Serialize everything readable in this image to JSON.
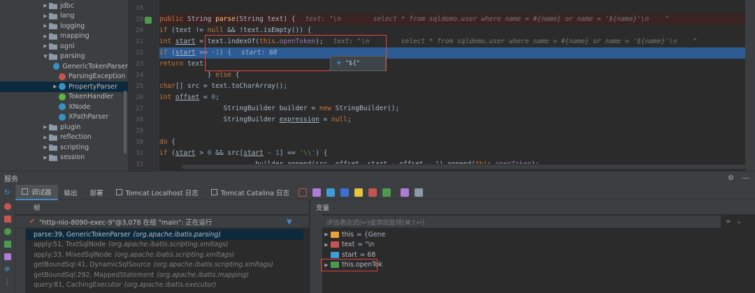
{
  "project_tree": {
    "items": [
      {
        "label": "jdbc",
        "type": "folder",
        "depth": 0,
        "expanded": false
      },
      {
        "label": "lang",
        "type": "folder",
        "depth": 0,
        "expanded": false
      },
      {
        "label": "logging",
        "type": "folder",
        "depth": 0,
        "expanded": false
      },
      {
        "label": "mapping",
        "type": "folder",
        "depth": 0,
        "expanded": false
      },
      {
        "label": "ognl",
        "type": "folder",
        "depth": 0,
        "expanded": false
      },
      {
        "label": "parsing",
        "type": "folder",
        "depth": 0,
        "expanded": true
      },
      {
        "label": "GenericTokenParser",
        "type": "class",
        "depth": 1
      },
      {
        "label": "ParsingException",
        "type": "exception",
        "depth": 1
      },
      {
        "label": "PropertyParser",
        "type": "class",
        "depth": 1,
        "selected": true,
        "expandable": true
      },
      {
        "label": "TokenHandler",
        "type": "interface",
        "depth": 1
      },
      {
        "label": "XNode",
        "type": "class",
        "depth": 1
      },
      {
        "label": "XPathParser",
        "type": "class",
        "depth": 1
      },
      {
        "label": "plugin",
        "type": "folder",
        "depth": 0,
        "expanded": false
      },
      {
        "label": "reflection",
        "type": "folder",
        "depth": 0,
        "expanded": false
      },
      {
        "label": "scripting",
        "type": "folder",
        "depth": 0,
        "expanded": false
      },
      {
        "label": "session",
        "type": "folder",
        "depth": 0,
        "expanded": false
      }
    ]
  },
  "editor": {
    "line_numbers": [
      "18",
      "19",
      "20",
      "21",
      "22",
      "23",
      "24",
      "25",
      "26",
      "27",
      "28",
      "29",
      "30",
      "31",
      "32"
    ],
    "inlay_text_line19": "text: \"\\n        select * from sqldemo.user where name = #{name} or name = '${name}'\\n    \"",
    "inlay_text_line21": "text: \"\\n        select * from sqldemo.user where name = #{name} or name = '${name}'\\n    \"",
    "inlay_start_line22": "start: 68",
    "hint_popup": "\"${\""
  },
  "services": {
    "title": "服务"
  },
  "debug_tabs": {
    "debugger": "调试器",
    "output": "输出",
    "deploy": "部署",
    "tomcat_localhost": "Tomcat Localhost 日志",
    "tomcat_catalina": "Tomcat Catalina 日志"
  },
  "frames": {
    "header": "帧",
    "thread": "\"http-nio-8090-exec-9\"@3,078 在组 \"main\": 正在运行",
    "items": [
      {
        "method": "parse:39, GenericTokenParser",
        "pkg": "(org.apache.ibatis.parsing)",
        "current": true
      },
      {
        "method": "apply:51, TextSqlNode",
        "pkg": "(org.apache.ibatis.scripting.xmltags)"
      },
      {
        "method": "apply:33, MixedSqlNode",
        "pkg": "(org.apache.ibatis.scripting.xmltags)"
      },
      {
        "method": "getBoundSql:41, DynamicSqlSource",
        "pkg": "(org.apache.ibatis.scripting.xmltags)"
      },
      {
        "method": "getBoundSql:292, MappedStatement",
        "pkg": "(org.apache.ibatis.mapping)"
      },
      {
        "method": "query:81, CachingExecutor",
        "pkg": "(org.apache.ibatis.executor)"
      }
    ]
  },
  "variables": {
    "header": "变量",
    "eval_placeholder": "评估表达式(↩)或添加监视(⌘⇧↩)",
    "items": [
      {
        "name": "this",
        "value": "= {Gene",
        "icon": "object"
      },
      {
        "name": "text",
        "value": "= \"\\n",
        "icon": "string"
      },
      {
        "name": "start",
        "value": "= 68",
        "icon": "int"
      },
      {
        "name": "this.openTok",
        "value": "",
        "icon": "watch"
      }
    ]
  },
  "colors": {
    "exec_line": "#2d5b93",
    "breakpoint_line": "#3a2323",
    "highlight_box": "#e0443e"
  }
}
